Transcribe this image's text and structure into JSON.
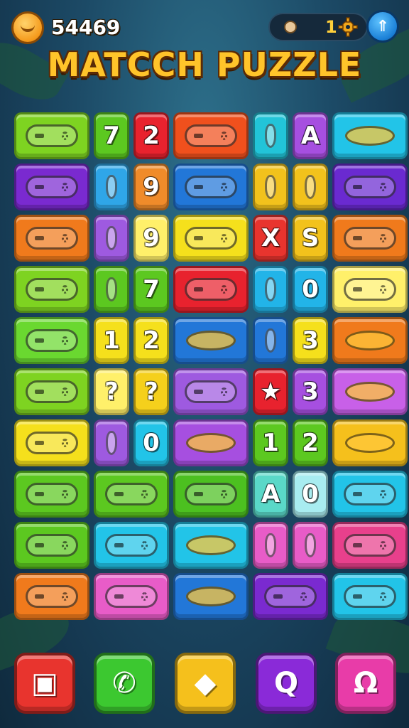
{
  "hud": {
    "score": "54469",
    "level": "1",
    "coin_icon": "coin-smile-icon",
    "pill_icon": "bell-icon",
    "settings_icon": "gear-icon",
    "upgrade_icon": "arrow-up-icon"
  },
  "title": "MATCCH PUZZLE",
  "board": {
    "rows": [
      [
        {
          "name": "gamepad",
          "color": "#7ed321",
          "label": "",
          "kind": "pad",
          "span": 2
        },
        {
          "name": "number-7",
          "color": "#5cc820",
          "label": "7",
          "kind": "text",
          "span": 1
        },
        {
          "name": "number-2",
          "color": "#e8222e",
          "label": "2",
          "kind": "text",
          "span": 1
        },
        {
          "name": "gamepad",
          "color": "#f0501d",
          "label": "",
          "kind": "pad",
          "span": 2
        },
        {
          "name": "strawberry",
          "color": "#22c4d8",
          "label": "",
          "kind": "fruit",
          "span": 1
        },
        {
          "name": "letter-a",
          "color": "#a64fe0",
          "label": "A",
          "kind": "text",
          "span": 1
        },
        {
          "name": "blob",
          "color": "#22c4e8",
          "label": "",
          "kind": "blob",
          "span": 2
        }
      ],
      [
        {
          "name": "gamepad",
          "color": "#7a2ad0",
          "label": "",
          "kind": "pad",
          "span": 2
        },
        {
          "name": "chef-hat",
          "color": "#2fa6e8",
          "label": "",
          "kind": "fruit",
          "span": 1
        },
        {
          "name": "number-9",
          "color": "#f08b2a",
          "label": "9",
          "kind": "text",
          "span": 1
        },
        {
          "name": "gamepad",
          "color": "#2277d8",
          "label": "",
          "kind": "pad",
          "span": 2
        },
        {
          "name": "hand",
          "color": "#f2c21c",
          "label": "",
          "kind": "fruit",
          "span": 1
        },
        {
          "name": "strawberry",
          "color": "#f2c21c",
          "label": "",
          "kind": "fruit",
          "span": 1
        },
        {
          "name": "gamepad",
          "color": "#6a2ad0",
          "label": "",
          "kind": "pad",
          "span": 2
        }
      ],
      [
        {
          "name": "gamepad",
          "color": "#f07a1c",
          "label": "",
          "kind": "pad",
          "span": 2
        },
        {
          "name": "apple",
          "color": "#9e5ae0",
          "label": "",
          "kind": "fruit",
          "span": 1
        },
        {
          "name": "number-9",
          "color": "#fff06a",
          "label": "9",
          "kind": "text",
          "span": 1
        },
        {
          "name": "gamepad",
          "color": "#f5e01c",
          "label": "",
          "kind": "pad",
          "span": 2
        },
        {
          "name": "star-x",
          "color": "#e8342e",
          "label": "X",
          "kind": "text",
          "span": 1
        },
        {
          "name": "letter-s",
          "color": "#f2c21c",
          "label": "S",
          "kind": "text",
          "span": 1
        },
        {
          "name": "gamepad",
          "color": "#f07a1c",
          "label": "",
          "kind": "pad",
          "span": 2
        }
      ],
      [
        {
          "name": "gamepad",
          "color": "#7ed321",
          "label": "",
          "kind": "pad",
          "span": 2
        },
        {
          "name": "strawberry",
          "color": "#5cc820",
          "label": "",
          "kind": "fruit",
          "span": 1
        },
        {
          "name": "number-7",
          "color": "#5cc820",
          "label": "7",
          "kind": "text",
          "span": 1
        },
        {
          "name": "gamepad",
          "color": "#e8222e",
          "label": "",
          "kind": "pad",
          "span": 2
        },
        {
          "name": "grape",
          "color": "#22b4e8",
          "label": "",
          "kind": "fruit",
          "span": 1
        },
        {
          "name": "number-0",
          "color": "#22b4e8",
          "label": "0",
          "kind": "text",
          "span": 1
        },
        {
          "name": "gamepad",
          "color": "#fff06a",
          "label": "",
          "kind": "pad",
          "span": 2
        }
      ],
      [
        {
          "name": "gamepad",
          "color": "#6ad830",
          "label": "",
          "kind": "pad",
          "span": 2
        },
        {
          "name": "number-1",
          "color": "#f5e01c",
          "label": "1",
          "kind": "text",
          "span": 1
        },
        {
          "name": "number-2",
          "color": "#f5e01c",
          "label": "2",
          "kind": "text",
          "span": 1
        },
        {
          "name": "bread",
          "color": "#2277d8",
          "label": "",
          "kind": "blob",
          "span": 2
        },
        {
          "name": "flower",
          "color": "#2277d8",
          "label": "",
          "kind": "fruit",
          "span": 1
        },
        {
          "name": "number-3",
          "color": "#f5e01c",
          "label": "3",
          "kind": "text",
          "span": 1
        },
        {
          "name": "bread",
          "color": "#f07a1c",
          "label": "",
          "kind": "blob",
          "span": 2
        }
      ],
      [
        {
          "name": "gamepad",
          "color": "#7ed321",
          "label": "",
          "kind": "pad",
          "span": 2
        },
        {
          "name": "question",
          "color": "#fff06a",
          "label": "?",
          "kind": "text",
          "span": 1
        },
        {
          "name": "question",
          "color": "#f5d01c",
          "label": "?",
          "kind": "text",
          "span": 1
        },
        {
          "name": "gamepad",
          "color": "#9e5ae0",
          "label": "",
          "kind": "pad",
          "span": 2
        },
        {
          "name": "star",
          "color": "#e8222e",
          "label": "★",
          "kind": "text",
          "span": 1
        },
        {
          "name": "number-3",
          "color": "#a64fe0",
          "label": "3",
          "kind": "text",
          "span": 1
        },
        {
          "name": "blob",
          "color": "#c860e8",
          "label": "",
          "kind": "blob",
          "span": 2
        }
      ],
      [
        {
          "name": "gamepad",
          "color": "#f5e01c",
          "label": "",
          "kind": "pad",
          "span": 2
        },
        {
          "name": "grape",
          "color": "#9e5ae0",
          "label": "",
          "kind": "fruit",
          "span": 1
        },
        {
          "name": "number-0",
          "color": "#22c4e8",
          "label": "0",
          "kind": "text",
          "span": 1
        },
        {
          "name": "bean",
          "color": "#a64fe0",
          "label": "",
          "kind": "blob",
          "span": 2
        },
        {
          "name": "number-1",
          "color": "#5cc820",
          "label": "1",
          "kind": "text",
          "span": 1
        },
        {
          "name": "number-2",
          "color": "#5cc820",
          "label": "2",
          "kind": "text",
          "span": 1
        },
        {
          "name": "bean",
          "color": "#f5c01c",
          "label": "",
          "kind": "blob",
          "span": 2
        }
      ],
      [
        {
          "name": "gamepad",
          "color": "#5cc820",
          "label": "",
          "kind": "pad",
          "span": 2
        },
        {
          "name": "gamepad",
          "color": "#5cc820",
          "label": "",
          "kind": "pad",
          "span": 2
        },
        {
          "name": "gamepad",
          "color": "#4cc020",
          "label": "",
          "kind": "pad",
          "span": 2
        },
        {
          "name": "letter-a",
          "color": "#5ad8c8",
          "label": "A",
          "kind": "text",
          "span": 1
        },
        {
          "name": "number-0",
          "color": "#a8ecf0",
          "label": "0",
          "kind": "text",
          "span": 1
        },
        {
          "name": "gamepad",
          "color": "#22c4e8",
          "label": "",
          "kind": "pad",
          "span": 2
        }
      ],
      [
        {
          "name": "gamepad",
          "color": "#5cc820",
          "label": "",
          "kind": "pad",
          "span": 2
        },
        {
          "name": "gamepad",
          "color": "#22c4e8",
          "label": "",
          "kind": "pad",
          "span": 2
        },
        {
          "name": "blob",
          "color": "#22c4e8",
          "label": "",
          "kind": "blob",
          "span": 2
        },
        {
          "name": "leaf",
          "color": "#e85cc8",
          "label": "",
          "kind": "fruit",
          "span": 1
        },
        {
          "name": "ghost",
          "color": "#e85cc8",
          "label": "",
          "kind": "fruit",
          "span": 1
        },
        {
          "name": "gamepad",
          "color": "#e8408c",
          "label": "",
          "kind": "pad",
          "span": 2
        }
      ],
      [
        {
          "name": "gamepad",
          "color": "#f07a1c",
          "label": "",
          "kind": "pad",
          "span": 2
        },
        {
          "name": "gamepad",
          "color": "#e85cc8",
          "label": "",
          "kind": "pad",
          "span": 2
        },
        {
          "name": "candy",
          "color": "#2277d8",
          "label": "",
          "kind": "blob",
          "span": 2
        },
        {
          "name": "key",
          "color": "#7a2ad0",
          "label": "",
          "kind": "pad",
          "span": 2
        },
        {
          "name": "gamepad",
          "color": "#22c4e8",
          "label": "",
          "kind": "pad",
          "span": 2
        }
      ]
    ]
  },
  "bottom_bar": [
    {
      "name": "robot-button",
      "icon": "robot-icon",
      "glyph": "▣",
      "color": "#e8342e"
    },
    {
      "name": "phone-button",
      "icon": "phone-icon",
      "glyph": "✆",
      "color": "#3cc830"
    },
    {
      "name": "fish-button",
      "icon": "fish-icon",
      "glyph": "◆",
      "color": "#f5c01c"
    },
    {
      "name": "search-button",
      "icon": "search-icon",
      "glyph": "Q",
      "color": "#8a2ad8"
    },
    {
      "name": "profile-button",
      "icon": "profile-icon",
      "glyph": "Ω",
      "color": "#e83ca8"
    }
  ]
}
